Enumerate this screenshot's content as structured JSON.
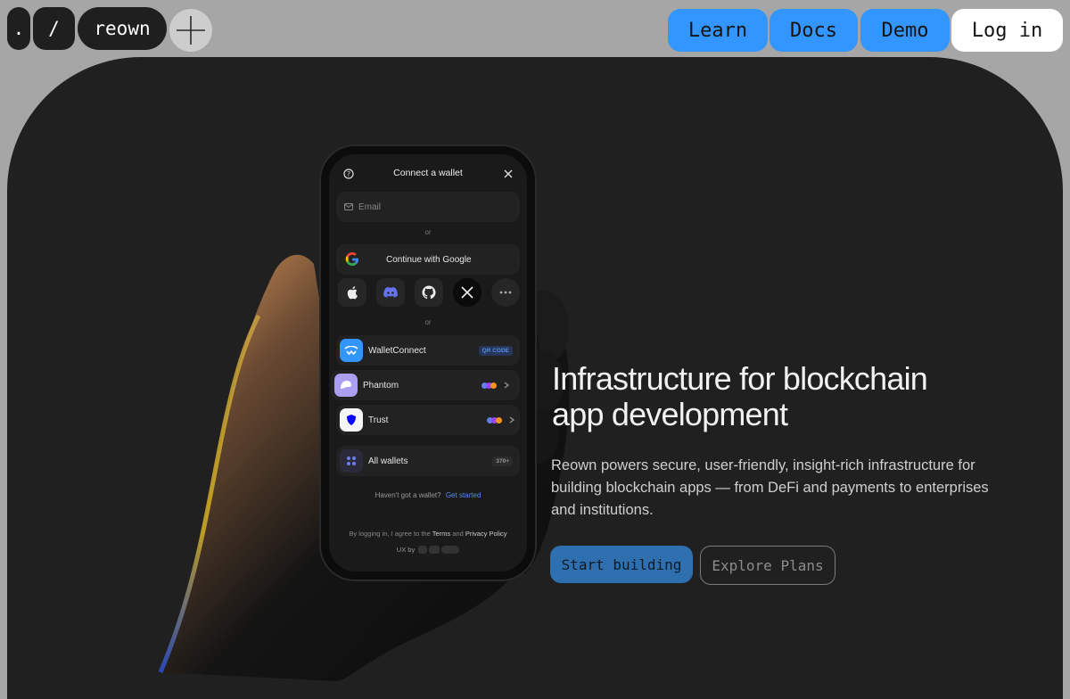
{
  "header": {
    "logo_dot": ".",
    "logo_slash": "/",
    "logo_name": "reown",
    "nav": {
      "learn": "Learn",
      "docs": "Docs",
      "demo": "Demo",
      "login": "Log in"
    }
  },
  "phone": {
    "title": "Connect a wallet",
    "email_placeholder": "Email",
    "or_1": "or",
    "google": "Continue with Google",
    "or_2": "or",
    "wallets": [
      {
        "name": "WalletConnect",
        "badge": "QR CODE"
      },
      {
        "name": "Phantom"
      },
      {
        "name": "Trust"
      },
      {
        "name": "All wallets",
        "badge": "370+"
      }
    ],
    "no_wallet": "Haven't got a wallet?",
    "get_started": "Get started",
    "terms_pre": "By logging in, I agree to the",
    "terms": "Terms",
    "and": "and",
    "privacy": "Privacy Policy",
    "ux_by": "UX by"
  },
  "hero": {
    "headline_line1": "Infrastructure for blockchain",
    "headline_line2": "app development",
    "description": "Reown powers secure, user-friendly, insight-rich infrastructure for building blockchain apps — from DeFi and payments to enterprises and institutions.",
    "cta_primary": "Start building",
    "cta_secondary": "Explore Plans"
  },
  "colors": {
    "accent": "#3396ff",
    "dark_panel": "#202020",
    "page_bg": "#a6a6a6"
  }
}
